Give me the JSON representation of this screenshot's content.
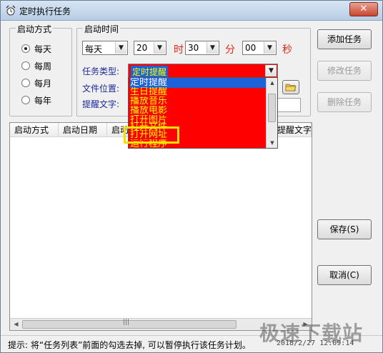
{
  "window": {
    "title": "定时执行任务",
    "close_glyph": "✕"
  },
  "start_mode": {
    "group_title": "启动方式",
    "options": [
      {
        "label": "每天",
        "checked": true
      },
      {
        "label": "每周",
        "checked": false
      },
      {
        "label": "每月",
        "checked": false
      },
      {
        "label": "每年",
        "checked": false
      }
    ]
  },
  "start_time": {
    "group_title": "启动时间",
    "frequency": "每天",
    "day": "20",
    "hour_unit": "时",
    "hour": "30",
    "minute_unit": "分",
    "minute": "00",
    "second_unit": "秒"
  },
  "task": {
    "type_label": "任务类型:",
    "type_value": "定时提醒",
    "file_label": "文件位置:",
    "reminder_label": "提醒文字:",
    "dropdown_options": [
      "定时提醒",
      "生日提醒",
      "播放音乐",
      "播放电影",
      "打开图片",
      "打开文件",
      "打开网址",
      "运行程序"
    ],
    "selected_option": "定时提醒",
    "highlighted_option": "打开网址"
  },
  "buttons": {
    "add": "添加任务",
    "edit": "修改任务",
    "delete": "删除任务",
    "save": "保存(S)",
    "cancel": "取消(C)"
  },
  "table": {
    "columns": [
      "启动方式",
      "启动日期",
      "启动",
      "提醒文字"
    ],
    "rows": [],
    "scroll_glyph": "|||"
  },
  "status": {
    "hint": "提示: 将“任务列表”前面的勾选去掉, 可以暂停执行该任务计划。",
    "datetime": "2018/2/27  12:09:14"
  },
  "watermark": "极速下载站",
  "colors": {
    "dropdown_bg": "#ff0000",
    "dropdown_text": "#ffff00",
    "selection": "#1c62d8",
    "highlight_box": "#f3e200",
    "unit_text": "#e8241c",
    "label_text": "#1c2a9a"
  },
  "icons": [
    "app-icon",
    "close-icon",
    "folder-icon",
    "chevron-down-icon"
  ]
}
